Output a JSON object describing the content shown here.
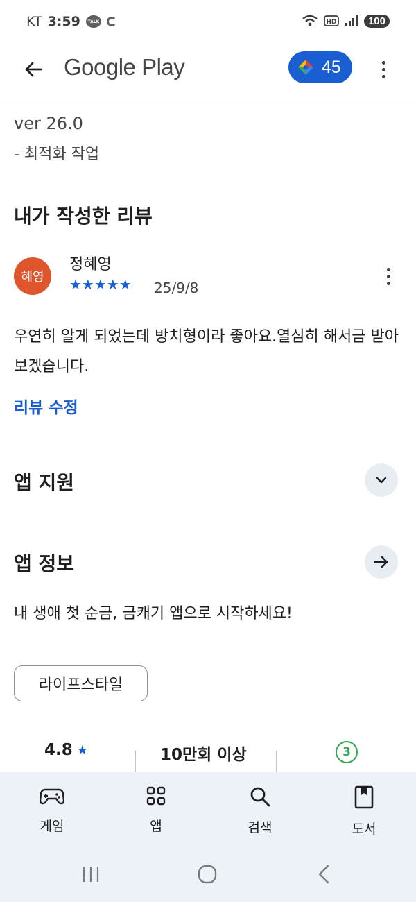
{
  "status_bar": {
    "carrier": "KT",
    "time": "3:59",
    "talk_label": "TALK",
    "battery": "100"
  },
  "app_bar": {
    "title": "Google Play",
    "points": "45"
  },
  "whats_new": {
    "version": "ver 26.0",
    "note": "- 최적화 작업"
  },
  "my_review": {
    "heading": "내가 작성한 리뷰",
    "avatar_text": "혜영",
    "reviewer": "정혜영",
    "rating": 5,
    "stars": "★★★★★",
    "date": "25/9/8",
    "text": "우연히 알게 되었는데 방치형이라 좋아요.열심히 해서금 받아보겠습니다.",
    "edit_label": "리뷰 수정"
  },
  "app_support": {
    "title": "앱 지원"
  },
  "app_info": {
    "title": "앱 정보",
    "description": "내 생애 첫 순금, 금캐기 앱으로 시작하세요!",
    "category": "라이프스타일"
  },
  "stats": {
    "rating": "4.8",
    "downloads": "10만회 이상",
    "age": "3"
  },
  "bottom_nav": [
    {
      "label": "게임",
      "icon": "gamepad-icon"
    },
    {
      "label": "앱",
      "icon": "apps-grid-icon"
    },
    {
      "label": "검색",
      "icon": "search-icon"
    },
    {
      "label": "도서",
      "icon": "book-icon"
    }
  ],
  "colors": {
    "accent": "#1a5fd1",
    "avatar": "#e0562c",
    "nav_bg": "#edf2f9",
    "age_badge": "#34a853"
  }
}
